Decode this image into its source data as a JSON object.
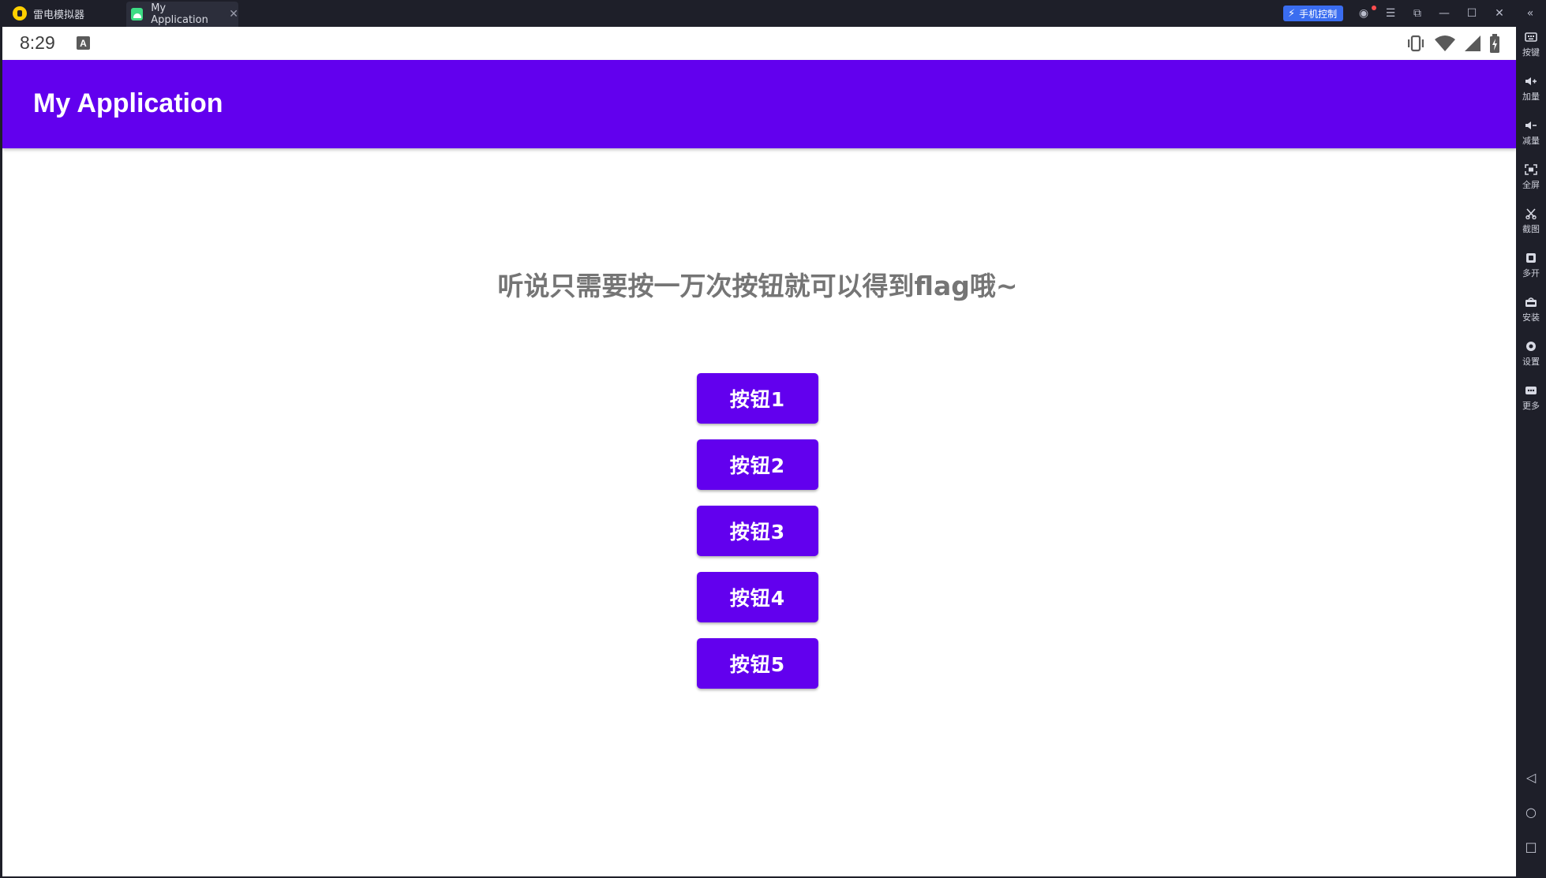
{
  "window": {
    "emulator_tab_label": "雷电模拟器",
    "app_tab_label": "My Application",
    "app_tab_close_glyph": "✕",
    "phone_control_label": "手机控制",
    "window_glyphs": {
      "account": "◉",
      "menu": "☰",
      "restore_small": "⧉",
      "minimize": "—",
      "maximize": "☐",
      "close": "✕",
      "collapse": "«"
    }
  },
  "status_bar": {
    "time": "8:29",
    "notification_letter": "A"
  },
  "app": {
    "title": "My Application",
    "headline": "听说只需要按一万次按钮就可以得到flag哦~",
    "buttons": [
      "按钮1",
      "按钮2",
      "按钮3",
      "按钮4",
      "按钮5"
    ],
    "accent_color": "#6200ee"
  },
  "sidebar": {
    "items": [
      {
        "label": "按键",
        "icon": "keyboard-icon"
      },
      {
        "label": "加量",
        "icon": "volume-up-icon"
      },
      {
        "label": "减量",
        "icon": "volume-down-icon"
      },
      {
        "label": "全屏",
        "icon": "fullscreen-icon"
      },
      {
        "label": "截图",
        "icon": "scissors-icon"
      },
      {
        "label": "多开",
        "icon": "multi-instance-icon"
      },
      {
        "label": "安装",
        "icon": "apk-install-icon"
      },
      {
        "label": "设置",
        "icon": "gear-icon"
      },
      {
        "label": "更多",
        "icon": "more-icon"
      }
    ],
    "nav": {
      "back": "◁",
      "home": "○",
      "recents": "□"
    }
  }
}
